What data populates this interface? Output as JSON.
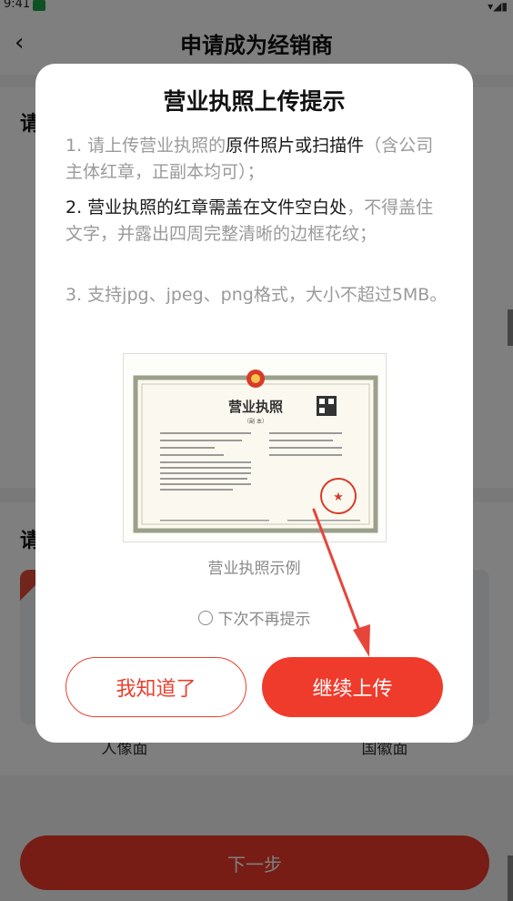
{
  "status_bar": {
    "time": "9:41"
  },
  "navbar": {
    "back_glyph": "‹",
    "title": "申请成为经销商"
  },
  "background": {
    "section1_heading": "请",
    "section2_heading": "请",
    "card_labels": [
      "人像面",
      "国徽面"
    ],
    "next_button": "下一步"
  },
  "dialog": {
    "title": "营业执照上传提示",
    "tip1": {
      "prefix": "1. 请上传营业执照的",
      "emphasis": "原件照片或扫描件",
      "suffix": "（含公司主体红章，正副本均可）；"
    },
    "tip2": {
      "emphasis": "2. 营业执照的红章需盖在文件空白处",
      "suffix": "，不得盖住文字，并露出四周完整清晰的边框花纹；"
    },
    "tip3": "3. 支持jpg、jpeg、png格式，大小不超过5MB。",
    "sample_caption": "营业执照示例",
    "dont_show_again": "下次不再提示",
    "btn_ok": "我知道了",
    "btn_continue": "继续上传"
  },
  "license_sample": {
    "title": "营业执照",
    "copy_type": "（副  本）"
  },
  "colors": {
    "accent": "#ef3b2b",
    "overlay": "rgba(0,0,0,0.5)"
  }
}
